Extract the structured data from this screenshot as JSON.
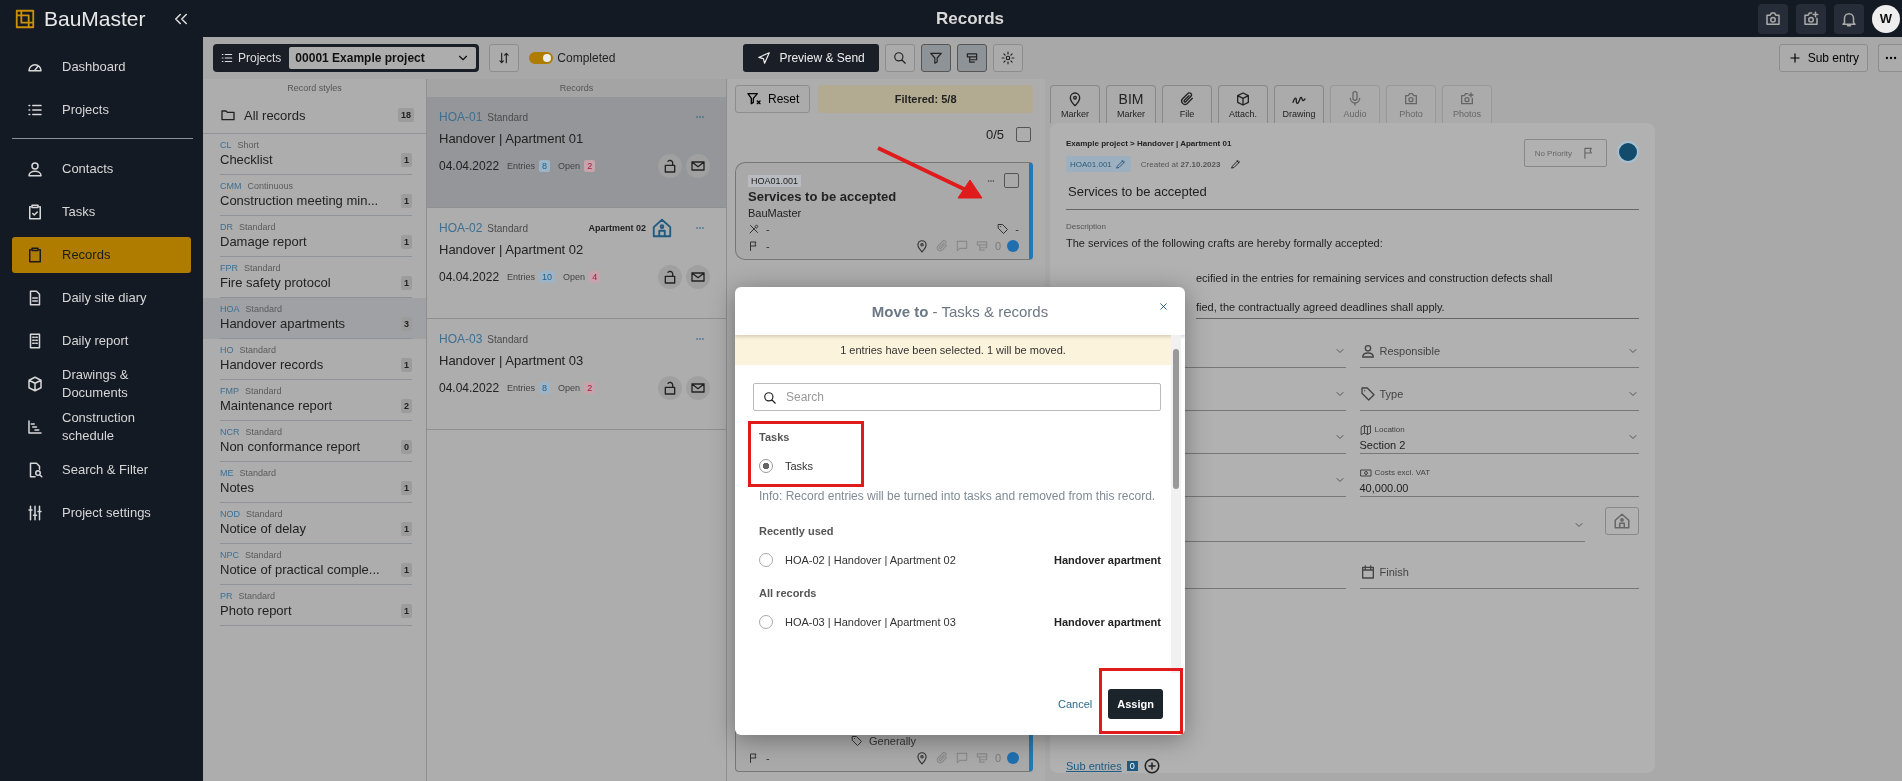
{
  "app": {
    "logo": "BauMaster",
    "title": "Records",
    "avatar": "W"
  },
  "nav_top": [
    {
      "label": "Dashboard",
      "selected": false
    },
    {
      "label": "Projects",
      "selected": false
    }
  ],
  "nav_main": [
    {
      "label": "Contacts",
      "selected": false
    },
    {
      "label": "Tasks",
      "selected": false
    },
    {
      "label": "Records",
      "selected": true
    },
    {
      "label": "Daily site diary",
      "selected": false
    },
    {
      "label": "Daily report",
      "selected": false
    },
    {
      "label": "Drawings & Documents",
      "selected": false
    },
    {
      "label": "Construction schedule",
      "selected": false
    },
    {
      "label": "Search & Filter",
      "selected": false
    },
    {
      "label": "Project settings",
      "selected": false
    }
  ],
  "toolbar": {
    "projects_label": "Projects",
    "project": "00001 Example project",
    "completed_label": "Completed",
    "completed_on": true,
    "preview_send": "Preview & Send",
    "filter_active": true,
    "grouping_active": true,
    "sub_entry": "Sub entry"
  },
  "record_styles": {
    "header": "Record styles",
    "all": {
      "label": "All records",
      "count": "18"
    },
    "items": [
      {
        "code": "CL",
        "type": "Short",
        "name": "Checklist",
        "count": "1",
        "selected": false
      },
      {
        "code": "CMM",
        "type": "Continuous",
        "name": "Construction meeting min...",
        "count": "1",
        "selected": false
      },
      {
        "code": "DR",
        "type": "Standard",
        "name": "Damage report",
        "count": "1",
        "selected": false
      },
      {
        "code": "FPR",
        "type": "Standard",
        "name": "Fire safety protocol",
        "count": "1",
        "selected": false
      },
      {
        "code": "HOA",
        "type": "Standard",
        "name": "Handover apartments",
        "count": "3",
        "selected": true
      },
      {
        "code": "HO",
        "type": "Standard",
        "name": "Handover records",
        "count": "1",
        "selected": false
      },
      {
        "code": "FMP",
        "type": "Standard",
        "name": "Maintenance report",
        "count": "2",
        "selected": false
      },
      {
        "code": "NCR",
        "type": "Standard",
        "name": "Non conformance report",
        "count": "0",
        "selected": false
      },
      {
        "code": "ME",
        "type": "Standard",
        "name": "Notes",
        "count": "1",
        "selected": false
      },
      {
        "code": "NOD",
        "type": "Standard",
        "name": "Notice of delay",
        "count": "1",
        "selected": false
      },
      {
        "code": "NPC",
        "type": "Standard",
        "name": "Notice of practical comple...",
        "count": "1",
        "selected": false
      },
      {
        "code": "PR",
        "type": "Standard",
        "name": "Photo report",
        "count": "1",
        "selected": false
      }
    ]
  },
  "records": {
    "header": "Records",
    "items": [
      {
        "code": "HOA-01",
        "type": "Standard",
        "title": "Handover | Apartment 01",
        "date": "04.04.2022",
        "entries_label": "Entries",
        "entries": "8",
        "open_label": "Open",
        "open": "2",
        "selected": true
      },
      {
        "code": "HOA-02",
        "type": "Standard",
        "title": "Handover | Apartment 02",
        "date": "04.04.2022",
        "entries_label": "Entries",
        "entries": "10",
        "open_label": "Open",
        "open": "4",
        "tag": "Apartment 02",
        "selected": false
      },
      {
        "code": "HOA-03",
        "type": "Standard",
        "title": "Handover | Apartment 03",
        "date": "04.04.2022",
        "entries_label": "Entries",
        "entries": "8",
        "open_label": "Open",
        "open": "2",
        "selected": false
      }
    ]
  },
  "entries": {
    "reset": "Reset",
    "filtered": "Filtered: 5/8",
    "counter": "0/5",
    "all_checked": false,
    "card": {
      "id": "HOA01.001",
      "title": "Services to be accepted",
      "company": "BauMaster",
      "trade": "-",
      "type": "-",
      "priority": "-",
      "comments": "0",
      "checked": false
    },
    "card_lower": {
      "type": "Generally",
      "priority": "-",
      "comments": "0"
    }
  },
  "detail": {
    "tabs": [
      {
        "label": "Marker",
        "disabled": false
      },
      {
        "top": "BIM",
        "label": "Marker",
        "disabled": false
      },
      {
        "label": "File",
        "disabled": false
      },
      {
        "label": "Attach.",
        "disabled": false
      },
      {
        "label": "Drawing",
        "disabled": false
      },
      {
        "label": "Audio",
        "disabled": true
      },
      {
        "label": "Photo",
        "disabled": true
      },
      {
        "label": "Photos",
        "disabled": true
      }
    ],
    "breadcrumb": "Example project > Handover | Apartment 01",
    "id": "HOA01.001",
    "created": "Created at **27.10.2023**",
    "priority": "No Priority",
    "title": "Services to be accepted",
    "description_label": "Description",
    "description_first": "The services of the following crafts are hereby formally accepted:",
    "description_continued": [
      "ecified in the entries for remaining services and construction defects shall",
      "fied, the contractually agreed deadlines shall apply."
    ],
    "fields": [
      {
        "label": "Responsible"
      },
      {
        "label": "Type"
      },
      {
        "label": "Location",
        "value": "Section 2"
      },
      {
        "label": "Costs excl. VAT",
        "value": "40,000.00"
      }
    ],
    "finish": "Finish",
    "sub_entries": "Sub entries",
    "sub_count": "0"
  },
  "modal": {
    "title_strong": "Move to",
    "title_rest": "- Tasks & records",
    "notice": "1 entries have been selected. 1 will be moved.",
    "search_placeholder": "Search",
    "sections": [
      {
        "heading": "Tasks",
        "info": "Info: Record entries will be turned into tasks and removed from this record.",
        "options": [
          {
            "label": "Tasks",
            "selected": true
          }
        ]
      },
      {
        "heading": "Recently used",
        "options": [
          {
            "label": "HOA-02 | Handover | Apartment 02",
            "style": "Handover apartment",
            "selected": false
          }
        ]
      },
      {
        "heading": "All records",
        "options": [
          {
            "label": "HOA-03 | Handover | Apartment 03",
            "style": "Handover apartment",
            "selected": false
          }
        ]
      }
    ],
    "cancel": "Cancel",
    "assign": "Assign"
  }
}
